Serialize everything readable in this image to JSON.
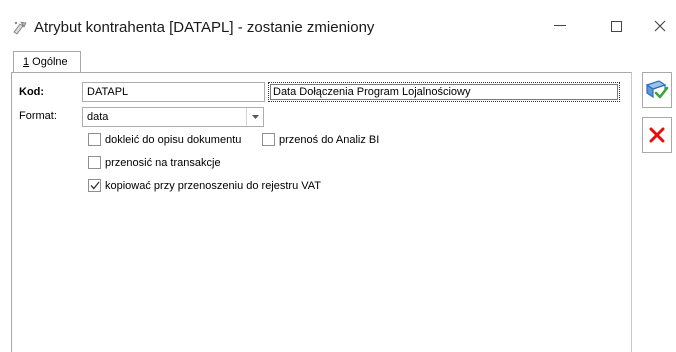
{
  "window": {
    "title": "Atrybut kontrahenta [DATAPL] - zostanie zmieniony",
    "icon": "attribute-icon",
    "controls": {
      "minimize": "—",
      "maximize": "☐",
      "close": "✕"
    }
  },
  "tabs": [
    {
      "hotkey": "1",
      "label": " Ogólne"
    }
  ],
  "form": {
    "kod_label": "Kod:",
    "kod_value": "DATAPL",
    "name_value": "Data Dołączenia Program Lojalnościowy",
    "format_label": "Format:",
    "format_value": "data",
    "checkboxes": [
      {
        "label": "dokleić do opisu dokumentu",
        "checked": false
      },
      {
        "label": "przenoś do Analiz BI",
        "checked": false
      },
      {
        "label": "przenosić na transakcje",
        "checked": false
      },
      {
        "label": "kopiować przy przenoszeniu do rejestru VAT",
        "checked": true
      }
    ]
  },
  "actions": {
    "save_icon": "save-icon",
    "cancel_icon": "cancel-icon"
  },
  "colors": {
    "save_blue": "#2f6fbf",
    "save_green": "#3aa63a",
    "cancel_red": "#e01010",
    "border": "#a9a9a9"
  }
}
